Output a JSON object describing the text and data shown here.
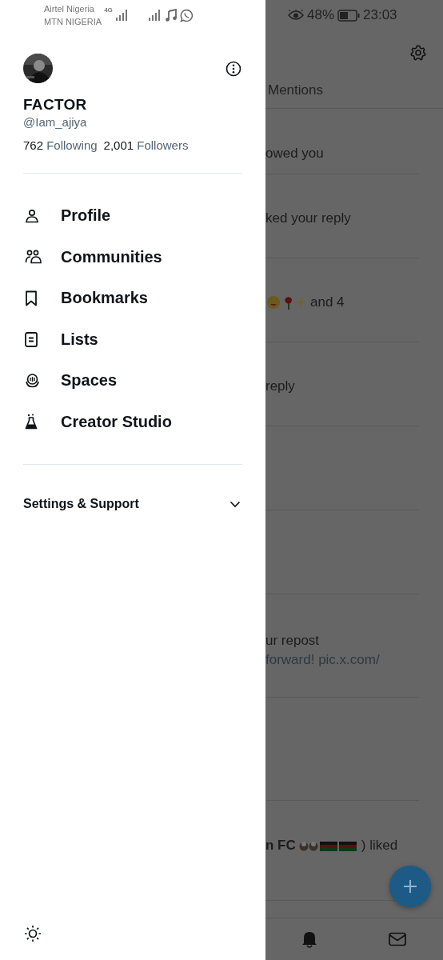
{
  "status_bar": {
    "carriers": [
      "Airtel Nigeria",
      "MTN NIGERIA"
    ],
    "network": "4G",
    "battery": "48%",
    "time": "23:03"
  },
  "drawer": {
    "name": "FACTOR",
    "handle": "@Iam_ajiya",
    "following_count": "762",
    "following_label": "Following",
    "followers_count": "2,001",
    "followers_label": "Followers",
    "menu": [
      {
        "label": "Profile",
        "kind": "person"
      },
      {
        "label": "Communities",
        "kind": "people"
      },
      {
        "label": "Bookmarks",
        "kind": "bookmark"
      },
      {
        "label": "Lists",
        "kind": "list"
      },
      {
        "label": "Spaces",
        "kind": "spaces"
      },
      {
        "label": "Creator Studio",
        "kind": "flask"
      }
    ],
    "settings": {
      "label": "Settings & Support",
      "expanded": false
    }
  },
  "feed": {
    "tab": "Mentions",
    "rows": [
      {
        "kind": "text",
        "lines": [
          "owed you"
        ]
      },
      {
        "kind": "text",
        "lines": [
          "ked your reply"
        ]
      },
      {
        "kind": "emoji",
        "lines": [
          "and 4"
        ]
      },
      {
        "kind": "text",
        "lines": [
          "reply"
        ]
      },
      {
        "kind": "blank"
      },
      {
        "kind": "blank"
      },
      {
        "kind": "text",
        "lines": [
          "ur repost",
          "forward! pic.x.com/"
        ]
      },
      {
        "kind": "blank"
      },
      {
        "kind": "flags",
        "lead": "n FC",
        "lines": [
          ") liked"
        ]
      }
    ]
  }
}
